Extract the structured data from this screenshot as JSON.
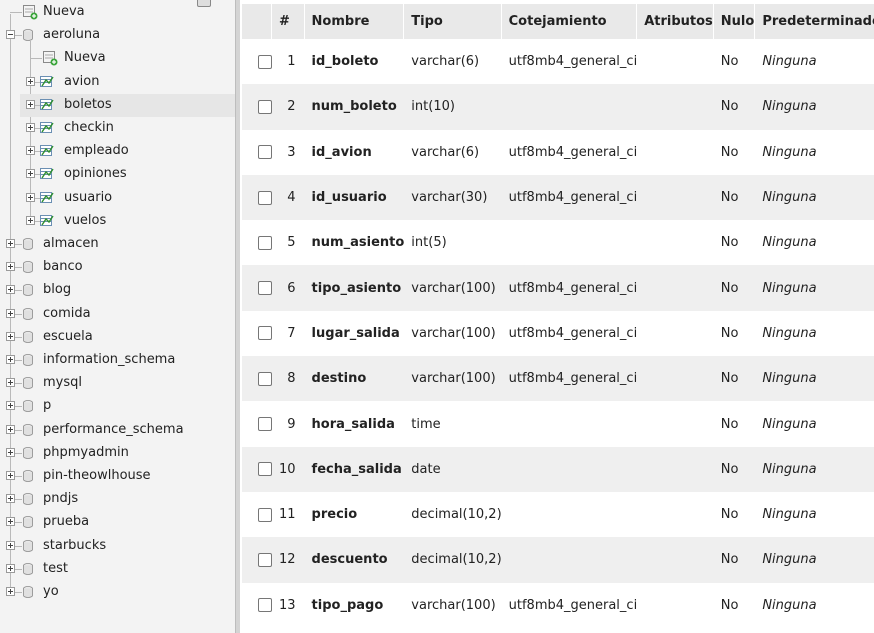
{
  "sidebar": {
    "new_label": "Nueva",
    "databases": [
      {
        "name": "aeroluna",
        "expanded": true,
        "children": [
          {
            "name": "Nueva",
            "kind": "new"
          },
          {
            "name": "avion",
            "kind": "table"
          },
          {
            "name": "boletos",
            "kind": "table",
            "selected": true
          },
          {
            "name": "checkin",
            "kind": "table"
          },
          {
            "name": "empleado",
            "kind": "table"
          },
          {
            "name": "opiniones",
            "kind": "table"
          },
          {
            "name": "usuario",
            "kind": "table"
          },
          {
            "name": "vuelos",
            "kind": "table"
          }
        ]
      },
      {
        "name": "almacen"
      },
      {
        "name": "banco"
      },
      {
        "name": "blog"
      },
      {
        "name": "comida"
      },
      {
        "name": "escuela"
      },
      {
        "name": "information_schema"
      },
      {
        "name": "mysql"
      },
      {
        "name": "p"
      },
      {
        "name": "performance_schema"
      },
      {
        "name": "phpmyadmin"
      },
      {
        "name": "pin-theowlhouse"
      },
      {
        "name": "pndjs"
      },
      {
        "name": "prueba"
      },
      {
        "name": "starbucks"
      },
      {
        "name": "test"
      },
      {
        "name": "yo"
      }
    ]
  },
  "structure": {
    "headers": [
      "",
      "#",
      "Nombre",
      "Tipo",
      "Cotejamiento",
      "Atributos",
      "Nulo",
      "Predeterminado"
    ],
    "rows": [
      {
        "n": "1",
        "name": "id_boleto",
        "type": "varchar(6)",
        "collation": "utf8mb4_general_ci",
        "attributes": "",
        "null": "No",
        "default": "Ninguna"
      },
      {
        "n": "2",
        "name": "num_boleto",
        "type": "int(10)",
        "collation": "",
        "attributes": "",
        "null": "No",
        "default": "Ninguna"
      },
      {
        "n": "3",
        "name": "id_avion",
        "type": "varchar(6)",
        "collation": "utf8mb4_general_ci",
        "attributes": "",
        "null": "No",
        "default": "Ninguna"
      },
      {
        "n": "4",
        "name": "id_usuario",
        "type": "varchar(30)",
        "collation": "utf8mb4_general_ci",
        "attributes": "",
        "null": "No",
        "default": "Ninguna"
      },
      {
        "n": "5",
        "name": "num_asiento",
        "type": "int(5)",
        "collation": "",
        "attributes": "",
        "null": "No",
        "default": "Ninguna"
      },
      {
        "n": "6",
        "name": "tipo_asiento",
        "type": "varchar(100)",
        "collation": "utf8mb4_general_ci",
        "attributes": "",
        "null": "No",
        "default": "Ninguna"
      },
      {
        "n": "7",
        "name": "lugar_salida",
        "type": "varchar(100)",
        "collation": "utf8mb4_general_ci",
        "attributes": "",
        "null": "No",
        "default": "Ninguna"
      },
      {
        "n": "8",
        "name": "destino",
        "type": "varchar(100)",
        "collation": "utf8mb4_general_ci",
        "attributes": "",
        "null": "No",
        "default": "Ninguna"
      },
      {
        "n": "9",
        "name": "hora_salida",
        "type": "time",
        "collation": "",
        "attributes": "",
        "null": "No",
        "default": "Ninguna"
      },
      {
        "n": "10",
        "name": "fecha_salida",
        "type": "date",
        "collation": "",
        "attributes": "",
        "null": "No",
        "default": "Ninguna"
      },
      {
        "n": "11",
        "name": "precio",
        "type": "decimal(10,2)",
        "collation": "",
        "attributes": "",
        "null": "No",
        "default": "Ninguna"
      },
      {
        "n": "12",
        "name": "descuento",
        "type": "decimal(10,2)",
        "collation": "",
        "attributes": "",
        "null": "No",
        "default": "Ninguna"
      },
      {
        "n": "13",
        "name": "tipo_pago",
        "type": "varchar(100)",
        "collation": "utf8mb4_general_ci",
        "attributes": "",
        "null": "No",
        "default": "Ninguna"
      }
    ]
  }
}
